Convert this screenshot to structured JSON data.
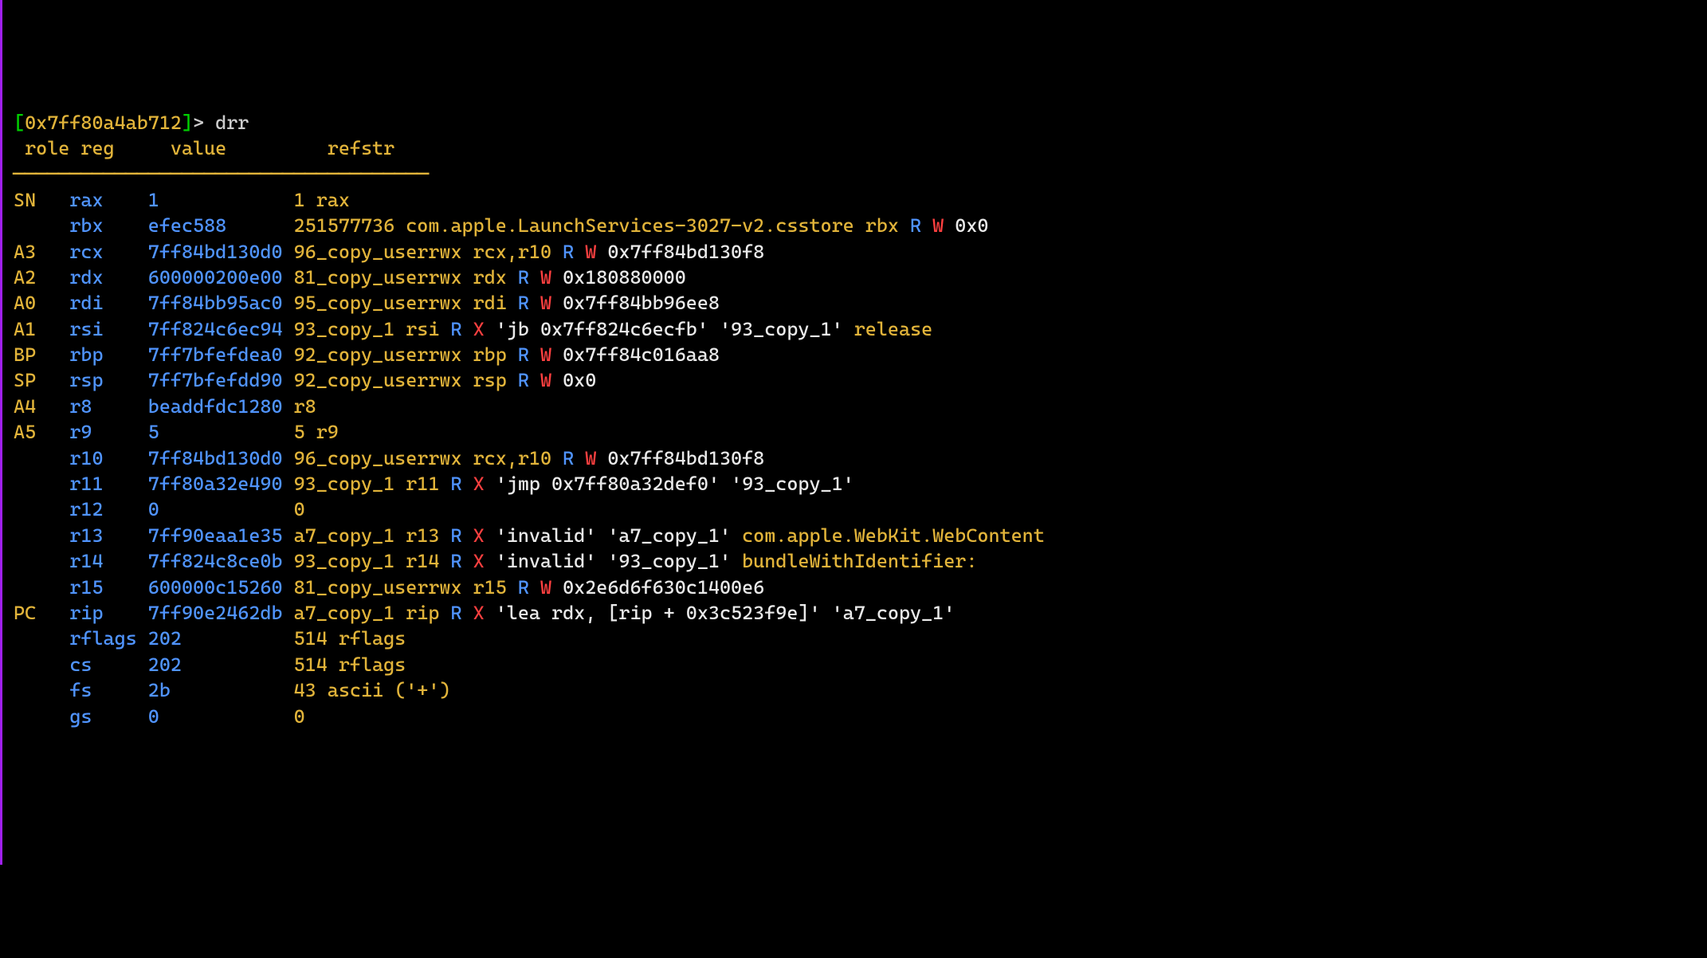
{
  "prompt": {
    "bracket_open": "[",
    "address": "0x7ff80a4ab712",
    "bracket_close": "]",
    "marker": "> ",
    "command": "drr"
  },
  "header": {
    "role_raw": " role",
    "reg_raw": "reg    ",
    "value_raw": "value        ",
    "refstr_raw": "refstr"
  },
  "divider": "─────────────────────────────────────",
  "rows": [
    {
      "role": "SN",
      "reg": "rax",
      "value": "1",
      "refstr": [
        {
          "cls": "c-yellow",
          "t": "1 rax"
        }
      ]
    },
    {
      "role": "",
      "reg": "rbx",
      "value": "efec588",
      "refstr": [
        {
          "cls": "c-yellow",
          "t": "251577736 com.apple.LaunchServices-3027-v2.csstore rbx "
        },
        {
          "cls": "c-blue",
          "t": "R "
        },
        {
          "cls": "c-red",
          "t": "W "
        },
        {
          "cls": "c-white",
          "t": "0x0"
        }
      ]
    },
    {
      "role": "A3",
      "reg": "rcx",
      "value": "7ff84bd130d0",
      "refstr": [
        {
          "cls": "c-yellow",
          "t": "96_copy_userrwx rcx,r10 "
        },
        {
          "cls": "c-blue",
          "t": "R "
        },
        {
          "cls": "c-red",
          "t": "W "
        },
        {
          "cls": "c-white",
          "t": "0x7ff84bd130f8"
        }
      ]
    },
    {
      "role": "A2",
      "reg": "rdx",
      "value": "600000200e00",
      "refstr": [
        {
          "cls": "c-yellow",
          "t": "81_copy_userrwx rdx "
        },
        {
          "cls": "c-blue",
          "t": "R "
        },
        {
          "cls": "c-red",
          "t": "W "
        },
        {
          "cls": "c-white",
          "t": "0x180880000"
        }
      ]
    },
    {
      "role": "A0",
      "reg": "rdi",
      "value": "7ff84bb95ac0",
      "refstr": [
        {
          "cls": "c-yellow",
          "t": "95_copy_userrwx rdi "
        },
        {
          "cls": "c-blue",
          "t": "R "
        },
        {
          "cls": "c-red",
          "t": "W "
        },
        {
          "cls": "c-white",
          "t": "0x7ff84bb96ee8"
        }
      ]
    },
    {
      "role": "A1",
      "reg": "rsi",
      "value": "7ff824c6ec94",
      "refstr": [
        {
          "cls": "c-yellow",
          "t": "93_copy_1 rsi "
        },
        {
          "cls": "c-blue",
          "t": "R "
        },
        {
          "cls": "c-red",
          "t": "X "
        },
        {
          "cls": "c-white",
          "t": "'jb 0x7ff824c6ecfb' '93_copy_1' "
        },
        {
          "cls": "c-yellow",
          "t": "release"
        }
      ]
    },
    {
      "role": "BP",
      "reg": "rbp",
      "value": "7ff7bfefdea0",
      "refstr": [
        {
          "cls": "c-yellow",
          "t": "92_copy_userrwx rbp "
        },
        {
          "cls": "c-blue",
          "t": "R "
        },
        {
          "cls": "c-red",
          "t": "W "
        },
        {
          "cls": "c-white",
          "t": "0x7ff84c016aa8"
        }
      ]
    },
    {
      "role": "SP",
      "reg": "rsp",
      "value": "7ff7bfefdd90",
      "refstr": [
        {
          "cls": "c-yellow",
          "t": "92_copy_userrwx rsp "
        },
        {
          "cls": "c-blue",
          "t": "R "
        },
        {
          "cls": "c-red",
          "t": "W "
        },
        {
          "cls": "c-white",
          "t": "0x0"
        }
      ]
    },
    {
      "role": "A4",
      "reg": "r8",
      "value": "beaddfdc1280",
      "refstr": [
        {
          "cls": "c-yellow",
          "t": "r8"
        }
      ]
    },
    {
      "role": "A5",
      "reg": "r9",
      "value": "5",
      "refstr": [
        {
          "cls": "c-yellow",
          "t": "5 r9"
        }
      ]
    },
    {
      "role": "",
      "reg": "r10",
      "value": "7ff84bd130d0",
      "refstr": [
        {
          "cls": "c-yellow",
          "t": "96_copy_userrwx rcx,r10 "
        },
        {
          "cls": "c-blue",
          "t": "R "
        },
        {
          "cls": "c-red",
          "t": "W "
        },
        {
          "cls": "c-white",
          "t": "0x7ff84bd130f8"
        }
      ]
    },
    {
      "role": "",
      "reg": "r11",
      "value": "7ff80a32e490",
      "refstr": [
        {
          "cls": "c-yellow",
          "t": "93_copy_1 r11 "
        },
        {
          "cls": "c-blue",
          "t": "R "
        },
        {
          "cls": "c-red",
          "t": "X "
        },
        {
          "cls": "c-white",
          "t": "'jmp 0x7ff80a32def0' '93_copy_1'"
        }
      ]
    },
    {
      "role": "",
      "reg": "r12",
      "value": "0",
      "refstr": [
        {
          "cls": "c-yellow",
          "t": "0"
        }
      ]
    },
    {
      "role": "",
      "reg": "r13",
      "value": "7ff90eaa1e35",
      "refstr": [
        {
          "cls": "c-yellow",
          "t": "a7_copy_1 r13 "
        },
        {
          "cls": "c-blue",
          "t": "R "
        },
        {
          "cls": "c-red",
          "t": "X "
        },
        {
          "cls": "c-white",
          "t": "'invalid' 'a7_copy_1' "
        },
        {
          "cls": "c-yellow",
          "t": "com.apple.WebKit.WebContent"
        }
      ]
    },
    {
      "role": "",
      "reg": "r14",
      "value": "7ff824c8ce0b",
      "refstr": [
        {
          "cls": "c-yellow",
          "t": "93_copy_1 r14 "
        },
        {
          "cls": "c-blue",
          "t": "R "
        },
        {
          "cls": "c-red",
          "t": "X "
        },
        {
          "cls": "c-white",
          "t": "'invalid' '93_copy_1' "
        },
        {
          "cls": "c-yellow",
          "t": "bundleWithIdentifier:"
        }
      ]
    },
    {
      "role": "",
      "reg": "r15",
      "value": "600000c15260",
      "refstr": [
        {
          "cls": "c-yellow",
          "t": "81_copy_userrwx r15 "
        },
        {
          "cls": "c-blue",
          "t": "R "
        },
        {
          "cls": "c-red",
          "t": "W "
        },
        {
          "cls": "c-white",
          "t": "0x2e6d6f630c1400e6"
        }
      ]
    },
    {
      "role": "PC",
      "reg": "rip",
      "value": "7ff90e2462db",
      "refstr": [
        {
          "cls": "c-yellow",
          "t": "a7_copy_1 rip "
        },
        {
          "cls": "c-blue",
          "t": "R "
        },
        {
          "cls": "c-red",
          "t": "X "
        },
        {
          "cls": "c-white",
          "t": "'lea rdx, [rip + 0x3c523f9e]' 'a7_copy_1'"
        }
      ]
    },
    {
      "role": "",
      "reg": "rflags",
      "value": "202",
      "refstr": [
        {
          "cls": "c-yellow",
          "t": "514 rflags"
        }
      ]
    },
    {
      "role": "",
      "reg": "cs",
      "value": "202",
      "refstr": [
        {
          "cls": "c-yellow",
          "t": "514 rflags"
        }
      ]
    },
    {
      "role": "",
      "reg": "fs",
      "value": "2b",
      "refstr": [
        {
          "cls": "c-yellow",
          "t": "43 ascii ('+')"
        }
      ]
    },
    {
      "role": "",
      "reg": "gs",
      "value": "0",
      "refstr": [
        {
          "cls": "c-yellow",
          "t": "0"
        }
      ]
    }
  ]
}
